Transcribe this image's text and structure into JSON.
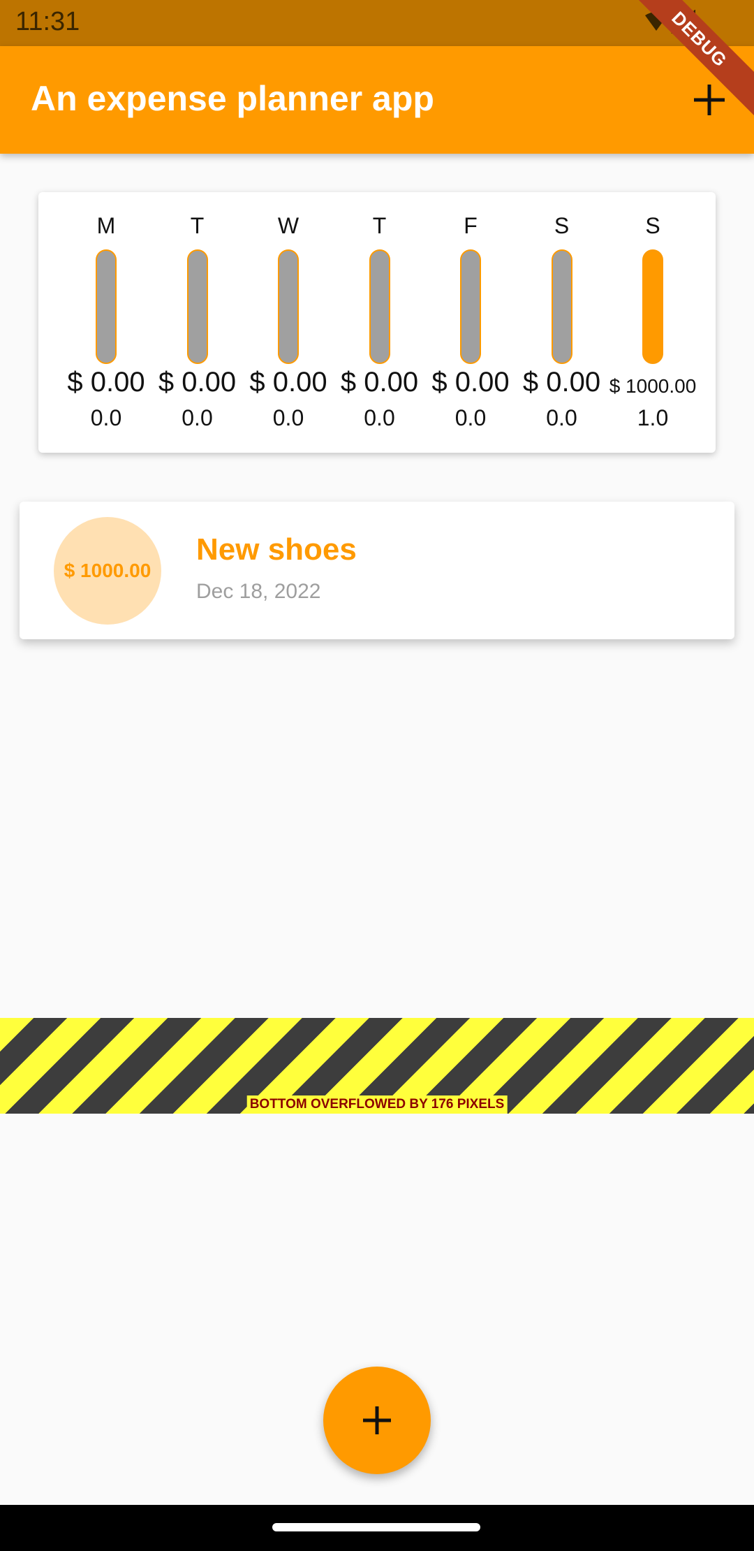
{
  "status_bar": {
    "time": "11:31"
  },
  "app_bar": {
    "title": "An expense planner app"
  },
  "debug_banner": "DEBUG",
  "chart_data": {
    "type": "bar",
    "categories": [
      "M",
      "T",
      "W",
      "T",
      "F",
      "S",
      "S"
    ],
    "amount_labels": [
      "$ 0.00",
      "$ 0.00",
      "$ 0.00",
      "$ 0.00",
      "$ 0.00",
      "$ 0.00",
      "$ 1000.00"
    ],
    "values": [
      0.0,
      0.0,
      0.0,
      0.0,
      0.0,
      0.0,
      1.0
    ],
    "value_labels": [
      "0.0",
      "0.0",
      "0.0",
      "0.0",
      "0.0",
      "0.0",
      "1.0"
    ],
    "ylim": [
      0,
      1
    ],
    "colors": {
      "fill": "#ff9a00",
      "track": "#a0a0a0"
    }
  },
  "transactions": [
    {
      "amount": "$ 1000.00",
      "title": "New shoes",
      "date": "Dec 18, 2022"
    }
  ],
  "overflow_warning": "BOTTOM OVERFLOWED BY 176 PIXELS",
  "colors": {
    "primary": "#ff9a00",
    "app_bar_status": "#bd7400"
  }
}
